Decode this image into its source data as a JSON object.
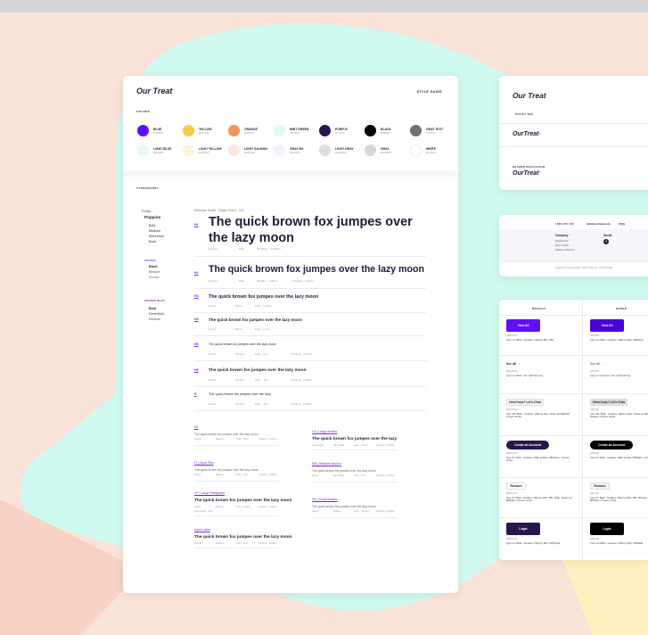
{
  "brand": "Our Treat",
  "main": {
    "style_guide": "STYLE GUIDE",
    "colors_label": "COLORS",
    "colors": [
      {
        "name": "BLUE",
        "hex": "#5F0EFF",
        "color": "#5f0eff"
      },
      {
        "name": "YELLOW",
        "hex": "#F9CA4A",
        "color": "#f9ca4a"
      },
      {
        "name": "ORANGE",
        "hex": "#FF8C5A",
        "color": "#f4935c"
      },
      {
        "name": "MINT GREEN",
        "hex": "#E0FFF8",
        "color": "#dffaf4"
      },
      {
        "name": "PURPLE",
        "hex": "#28174F",
        "color": "#28174f"
      },
      {
        "name": "BLACK",
        "hex": "#000000",
        "color": "#000000"
      },
      {
        "name": "GRAY TEXT",
        "hex": "#707070",
        "color": "#707070"
      },
      {
        "name": "LIGHT BLUE",
        "hex": "#EEF8FF",
        "color": "#e9f5f9"
      },
      {
        "name": "LIGHT YELLOW",
        "hex": "#FFF5E2",
        "color": "#fff2dc"
      },
      {
        "name": "LIGHT SALMON",
        "hex": "#FDECE4",
        "color": "#fce6de"
      },
      {
        "name": "GRAY BG",
        "hex": "#F6F5FA",
        "color": "#f4f3f9"
      },
      {
        "name": "LIGHT GRAY",
        "hex": "#DEDEDE",
        "color": "#dedede"
      },
      {
        "name": "GRAY",
        "hex": "#D8D8D8",
        "color": "#d8d8d8"
      },
      {
        "name": "WHITE",
        "hex": "#FFFFFF",
        "color": "#ffffff"
      }
    ],
    "typography_label": "TYPOGRAPHY",
    "fonts_label": "Fonts",
    "font_poppins": "Poppins",
    "poppins_weights": [
      "Bold",
      "Midform",
      "Semi-Bold",
      "Book"
    ],
    "font_avenir": "AVENIR",
    "avenir_weights": [
      "Black",
      "Medium",
      "Roman"
    ],
    "font_avenir_next": "AVENIR NEXT",
    "avenir_next_weights": [
      "Bold",
      "Demi Bold",
      "Medium"
    ],
    "scale_label": "Modular Scale : Major Third - 4:5",
    "headings": [
      {
        "tag": "H1",
        "text": "The quick brown fox jumpes over the lazy moon",
        "meta": [
          "Poppins",
          "Bold",
          "35.260px · 3.400em"
        ]
      },
      {
        "tag": "H2",
        "text": "The quick brown fox jumpes over the lazy moon",
        "meta": [
          "Poppins",
          "Bold",
          "28.00px · 2.00em",
          "Tracking : 0.02em"
        ]
      },
      {
        "tag": "H3",
        "text": "The quick brown fox jumpes over the lazy moon",
        "meta": [
          "Avenir",
          "Black",
          "19px · 1.25em"
        ]
      },
      {
        "tag": "H4",
        "text": "The quick brown fox jumpes over the lazy moon",
        "meta": [
          "Avenir",
          "Black",
          "16px · 1.2em"
        ]
      },
      {
        "tag": "H5",
        "text": "The quick brown fox jumpes over the lazy moon",
        "meta": [
          "Avenir",
          "Medium",
          "14px · 1em",
          "Tracking : 0.07em"
        ]
      },
      {
        "tag": "H6",
        "text": "The quick brown fox jumpes over the lazy moon",
        "meta": [
          "Avenir",
          "Medium",
          "13px · .8em",
          "Tracking : 0.03em"
        ]
      },
      {
        "tag": "P",
        "text": "The quick brown fox jumpes over the lazy",
        "meta": [
          "Avenir",
          "Medium",
          "11px · .8em",
          "Tracking : 0.03em"
        ]
      }
    ],
    "samples_left": [
      {
        "tag": "S2",
        "text": "The quick brown fox jumpes over the lazy moon",
        "meta": [
          "Avenir",
          "Medium",
          "11px · .8em",
          "Tracking : 0.07em"
        ]
      },
      {
        "tag": "IT | Input Text",
        "text": "The quick brown fox jumpes over the lazy moon",
        "meta": [
          "Avenir",
          "Medium",
          "13px · 1em",
          "Tracking : 0.02em"
        ]
      },
      {
        "tag": "LP | Large Paragraph",
        "text": "The quick brown fox jumpes over the lazy moon",
        "meta": [
          "Avenir",
          "Medium",
          "16px · 1.4em",
          "Tracking : 0.01em"
        ],
        "extra": "Line Height : 24px"
      },
      {
        "tag": "Input Label",
        "text": "The quick brown fox jumpes over the lazy moon",
        "meta": [
          "Avenir",
          "Medium",
          "14px · 1em",
          "Tracking : 0.04em"
        ]
      }
    ],
    "samples_right": [
      {
        "tag": "LA | Large Anchor",
        "text": "The quick brown fox jumpes over the lazy",
        "meta": [
          "Avenir Next",
          "Demi Bold",
          "14px · 1.10em",
          "Tracking : 0.02em"
        ]
      },
      {
        "tag": "MA | Medium Anchor",
        "text": "The quick brown fox jumpes over the lazy moon",
        "meta": [
          "Avenir",
          "Demi Bold",
          "13px · 1em",
          "Tracking : 0.03em"
        ]
      },
      {
        "tag": "SA | Small Anchor",
        "text": "The quick brown fox jumpes over the lazy moon",
        "meta": [
          "Avenir",
          "Medium",
          "11px · .8/1.4em",
          "Tracking : 0.02em"
        ]
      }
    ]
  },
  "right": {
    "nav_title": "Our Treat",
    "sticky_nav": "STICKY NAV",
    "logo1": "OurTreat",
    "header_nav": "HEADER NAVIGATION",
    "logo2": "OurTreat",
    "footer_phone": "1900 470 100",
    "footer_email": "hello@ourtreat.com",
    "footer_faqs": "FAQs",
    "company": "Company",
    "company_links": [
      "Departments",
      "How it works",
      "Delivery & Returns"
    ],
    "social": "Social",
    "copyright": "Copyright ©Ourtreat 2019 · Terms of Service · Privacy Policy",
    "col_default": "DEFAULT",
    "col_hover": "HOVER",
    "btn_view_all": "View All",
    "btn_see_all": "See All →",
    "btn_need_help": "Need help? Let's Chat",
    "btn_create": "Create an Account",
    "btn_remove": "Remove",
    "btn_login": "Login",
    "state_default": "DEFAULT",
    "state_hover": "HOVER",
    "notes_default": [
      "Type: LA / White · Container: 130px by 45px / Blue",
      "Type: LA / Black · Icon: right-arrow.svg",
      "Type: MA / Black · Container: 180px by 40px / Stroke 1px #E7E7E7 · Corners: 22.5px",
      "Type: PI / White · Container: 138px by 40px / PIB Purple · Corners: 22.5px",
      "Type: PI / Black · Container: 130px by 25px / PIB / White · Stroke: 1px #E7E7E7 / Corners: 17.5px",
      "Type: LA / White · Container: 130px by 45px / PIB Purple"
    ],
    "notes_hover": [
      "Type: LA / White · Container: 130px by 45px / #5E2Emm",
      "Type: LA / Gray Text · Icon: right-arrow.svg",
      "Type: MA / Black · Container: 180px by 40px / Stroke 1px #E7E7E7 · Fill: #dedede / Corners: 22.5px",
      "Type: PI / White · Container: 138px by 40px / PIB Black · Corners: 22.5px",
      "Type: PI / Black · Container: 130px by 25px / PIB / Monnkee · Stroke: 1px #E7E7E7 / Corners: 17.5px",
      "Type: LA / White · Container: 130px by 45px / PIB Black"
    ]
  }
}
